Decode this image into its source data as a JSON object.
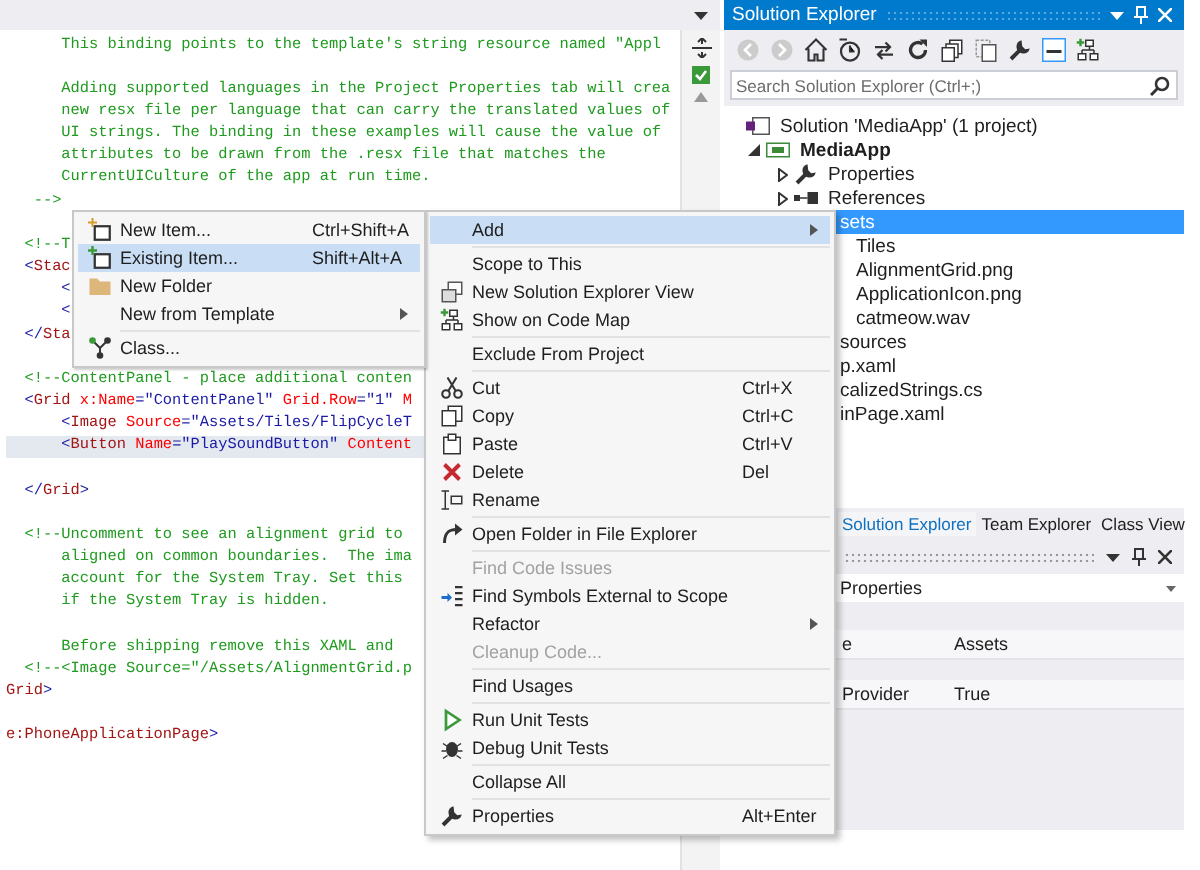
{
  "editor": {
    "lines": [
      {
        "highlighted": false,
        "tokens": [
          {
            "kind": "comment",
            "text": "      This binding points to the template's string resource named \"Appl"
          }
        ]
      },
      {
        "highlighted": false
      },
      {
        "highlighted": false,
        "tokens": [
          {
            "kind": "comment",
            "text": "      Adding supported languages in the Project Properties tab will crea"
          }
        ]
      },
      {
        "highlighted": false,
        "tokens": [
          {
            "kind": "comment",
            "text": "      new resx file per language that can carry the translated values of"
          }
        ]
      },
      {
        "highlighted": false,
        "tokens": [
          {
            "kind": "comment",
            "text": "      UI strings. The binding in these examples will cause the value of"
          }
        ]
      },
      {
        "highlighted": false,
        "tokens": [
          {
            "kind": "comment",
            "text": "      attributes to be drawn from the .resx file that matches the"
          }
        ]
      },
      {
        "highlighted": false,
        "tokens": [
          {
            "kind": "comment",
            "text": "      CurrentUICulture of the app at run time."
          }
        ]
      },
      {
        "highlighted": false,
        "tokens": [
          {
            "kind": "comment",
            "text": "   -->"
          }
        ]
      },
      {
        "highlighted": false
      },
      {
        "highlighted": false,
        "tokens": [
          {
            "kind": "comment",
            "text": "  <!--T"
          }
        ]
      },
      {
        "highlighted": false,
        "tokens": [
          {
            "kind": "markup",
            "text": "  <"
          },
          {
            "kind": "element",
            "text": "Stac"
          }
        ]
      },
      {
        "highlighted": false,
        "tokens": [
          {
            "kind": "markup",
            "text": "      <"
          }
        ]
      },
      {
        "highlighted": false,
        "tokens": [
          {
            "kind": "markup",
            "text": "      <"
          }
        ]
      },
      {
        "highlighted": false,
        "tokens": [
          {
            "kind": "markup",
            "text": "  </"
          },
          {
            "kind": "element",
            "text": "Sta"
          }
        ]
      },
      {
        "highlighted": false
      },
      {
        "highlighted": false,
        "tokens": [
          {
            "kind": "comment",
            "text": "  <!--ContentPanel - place additional conten"
          }
        ]
      },
      {
        "highlighted": false,
        "tokens": [
          {
            "kind": "markup",
            "text": "  <"
          },
          {
            "kind": "element",
            "text": "Grid"
          },
          {
            "kind": "attribute",
            "text": " x:Name"
          },
          {
            "kind": "markup",
            "text": "=\"ContentPanel\""
          },
          {
            "kind": "attribute",
            "text": " Grid.Row"
          },
          {
            "kind": "markup",
            "text": "=\"1\""
          },
          {
            "kind": "attribute",
            "text": " M"
          }
        ]
      },
      {
        "highlighted": false,
        "tokens": [
          {
            "kind": "markup",
            "text": "      <"
          },
          {
            "kind": "element",
            "text": "Image"
          },
          {
            "kind": "attribute",
            "text": " Source"
          },
          {
            "kind": "markup",
            "text": "=\"Assets/Tiles/FlipCycleT"
          }
        ]
      },
      {
        "highlighted": true,
        "tokens": [
          {
            "kind": "markup",
            "text": "      <"
          },
          {
            "kind": "element",
            "text": "Button"
          },
          {
            "kind": "attribute",
            "text": " Name"
          },
          {
            "kind": "markup",
            "text": "=\"PlaySoundButton\""
          },
          {
            "kind": "attribute",
            "text": " Content"
          }
        ]
      },
      {
        "highlighted": false
      },
      {
        "highlighted": false,
        "tokens": [
          {
            "kind": "markup",
            "text": "  </"
          },
          {
            "kind": "element",
            "text": "Grid"
          },
          {
            "kind": "markup",
            "text": ">"
          }
        ]
      },
      {
        "highlighted": false
      },
      {
        "highlighted": false,
        "tokens": [
          {
            "kind": "comment",
            "text": "  <!--Uncomment to see an alignment grid to"
          }
        ]
      },
      {
        "highlighted": false,
        "tokens": [
          {
            "kind": "comment",
            "text": "      aligned on common boundaries.  The ima"
          }
        ]
      },
      {
        "highlighted": false,
        "tokens": [
          {
            "kind": "comment",
            "text": "      account for the System Tray. Set this"
          }
        ]
      },
      {
        "highlighted": false,
        "tokens": [
          {
            "kind": "comment",
            "text": "      if the System Tray is hidden."
          }
        ]
      },
      {
        "highlighted": false
      },
      {
        "highlighted": false,
        "tokens": [
          {
            "kind": "comment",
            "text": "      Before shipping remove this XAML and"
          }
        ]
      },
      {
        "highlighted": false,
        "tokens": [
          {
            "kind": "comment",
            "text": "  <!--<Image Source=\"/Assets/AlignmentGrid.p"
          }
        ]
      },
      {
        "highlighted": false,
        "tokens": [
          {
            "kind": "element",
            "text": "Grid"
          },
          {
            "kind": "markup",
            "text": ">"
          }
        ]
      },
      {
        "highlighted": false
      },
      {
        "highlighted": false,
        "tokens": [
          {
            "kind": "element",
            "text": "e:PhoneApplicationPage"
          },
          {
            "kind": "markup",
            "text": ">"
          }
        ]
      }
    ]
  },
  "solution_explorer": {
    "title": "Solution Explorer",
    "search": {
      "placeholder": "Search Solution Explorer (Ctrl+;)"
    },
    "tree": [
      {
        "label": "Solution 'MediaApp' (1 project)",
        "kind": "solution",
        "selected": false,
        "children": [
          {
            "label": "MediaApp",
            "kind": "project",
            "expanded": true,
            "selected": false,
            "children": [
              {
                "label": "Properties",
                "kind": "properties",
                "expanded": false,
                "selected": false
              },
              {
                "label": "References",
                "kind": "references",
                "expanded": false,
                "selected": false
              },
              {
                "label": "sets",
                "selected": true,
                "children": [
                  {
                    "label": "Tiles",
                    "selected": false
                  },
                  {
                    "label": "AlignmentGrid.png",
                    "selected": false
                  },
                  {
                    "label": "ApplicationIcon.png",
                    "selected": false
                  },
                  {
                    "label": "catmeow.wav",
                    "selected": false
                  }
                ]
              },
              {
                "label": "sources",
                "selected": false
              },
              {
                "label": "p.xaml",
                "selected": false
              },
              {
                "label": "calizedStrings.cs",
                "selected": false
              },
              {
                "label": "inPage.xaml",
                "selected": false
              }
            ]
          }
        ]
      }
    ]
  },
  "tool_tabs": [
    {
      "label": "Solution Explorer",
      "selected": true
    },
    {
      "label": "Team Explorer",
      "selected": false
    },
    {
      "label": "Class View",
      "selected": false
    }
  ],
  "properties_panel": {
    "dropdown": "Properties",
    "rows": [
      {
        "name": "e",
        "value": "Assets"
      },
      {
        "name": "Provider",
        "value": "True"
      }
    ]
  },
  "context_menu": {
    "items": [
      {
        "kind": "plain",
        "label": "Add",
        "submenu": true,
        "selected": true,
        "disabled": false
      },
      {
        "kind": "separator"
      },
      {
        "kind": "plain",
        "label": "Scope to This",
        "submenu": false,
        "selected": false,
        "disabled": false
      },
      {
        "kind": "new-view",
        "label": "New Solution Explorer View",
        "submenu": false,
        "selected": false,
        "disabled": false
      },
      {
        "kind": "code-map",
        "label": "Show on Code Map",
        "submenu": false,
        "selected": false,
        "disabled": false
      },
      {
        "kind": "separator"
      },
      {
        "kind": "plain",
        "label": "Exclude From Project",
        "submenu": false,
        "selected": false,
        "disabled": false
      },
      {
        "kind": "separator"
      },
      {
        "kind": "cut",
        "label": "Cut",
        "shortcut": "Ctrl+X",
        "submenu": false,
        "selected": false,
        "disabled": false
      },
      {
        "kind": "copy",
        "label": "Copy",
        "shortcut": "Ctrl+C",
        "submenu": false,
        "selected": false,
        "disabled": false
      },
      {
        "kind": "paste",
        "label": "Paste",
        "shortcut": "Ctrl+V",
        "submenu": false,
        "selected": false,
        "disabled": false
      },
      {
        "kind": "delete",
        "label": "Delete",
        "shortcut": "Del",
        "submenu": false,
        "selected": false,
        "disabled": false
      },
      {
        "kind": "rename",
        "label": "Rename",
        "submenu": false,
        "selected": false,
        "disabled": false
      },
      {
        "kind": "separator"
      },
      {
        "kind": "open-folder",
        "label": "Open Folder in File Explorer",
        "submenu": false,
        "selected": false,
        "disabled": false
      },
      {
        "kind": "separator"
      },
      {
        "kind": "plain",
        "label": "Find Code Issues",
        "submenu": false,
        "selected": false,
        "disabled": true
      },
      {
        "kind": "find-symbols",
        "label": "Find Symbols External to Scope",
        "submenu": false,
        "selected": false,
        "disabled": false
      },
      {
        "kind": "plain",
        "label": "Refactor",
        "submenu": true,
        "selected": false,
        "disabled": false
      },
      {
        "kind": "plain",
        "label": "Cleanup Code...",
        "submenu": false,
        "selected": false,
        "disabled": true
      },
      {
        "kind": "separator"
      },
      {
        "kind": "plain",
        "label": "Find Usages",
        "submenu": false,
        "selected": false,
        "disabled": false
      },
      {
        "kind": "separator"
      },
      {
        "kind": "run-tests",
        "label": "Run Unit Tests",
        "submenu": false,
        "selected": false,
        "disabled": false
      },
      {
        "kind": "debug-tests",
        "label": "Debug Unit Tests",
        "submenu": false,
        "selected": false,
        "disabled": false
      },
      {
        "kind": "separator"
      },
      {
        "kind": "plain",
        "label": "Collapse All",
        "submenu": false,
        "selected": false,
        "disabled": false
      },
      {
        "kind": "separator"
      },
      {
        "kind": "properties",
        "label": "Properties",
        "shortcut": "Alt+Enter",
        "submenu": false,
        "selected": false,
        "disabled": false
      }
    ]
  },
  "add_submenu": {
    "items": [
      {
        "kind": "new-item",
        "label": "New Item...",
        "shortcut": "Ctrl+Shift+A",
        "submenu": false,
        "selected": false,
        "disabled": false
      },
      {
        "kind": "existing-item",
        "label": "Existing Item...",
        "shortcut": "Shift+Alt+A",
        "submenu": false,
        "selected": true,
        "disabled": false
      },
      {
        "kind": "new-folder",
        "label": "New Folder",
        "submenu": false,
        "selected": false,
        "disabled": false
      },
      {
        "kind": "plain",
        "label": "New from Template",
        "submenu": true,
        "selected": false,
        "disabled": false
      },
      {
        "kind": "separator"
      },
      {
        "kind": "class",
        "label": "Class...",
        "submenu": false,
        "selected": false,
        "disabled": false
      }
    ]
  }
}
